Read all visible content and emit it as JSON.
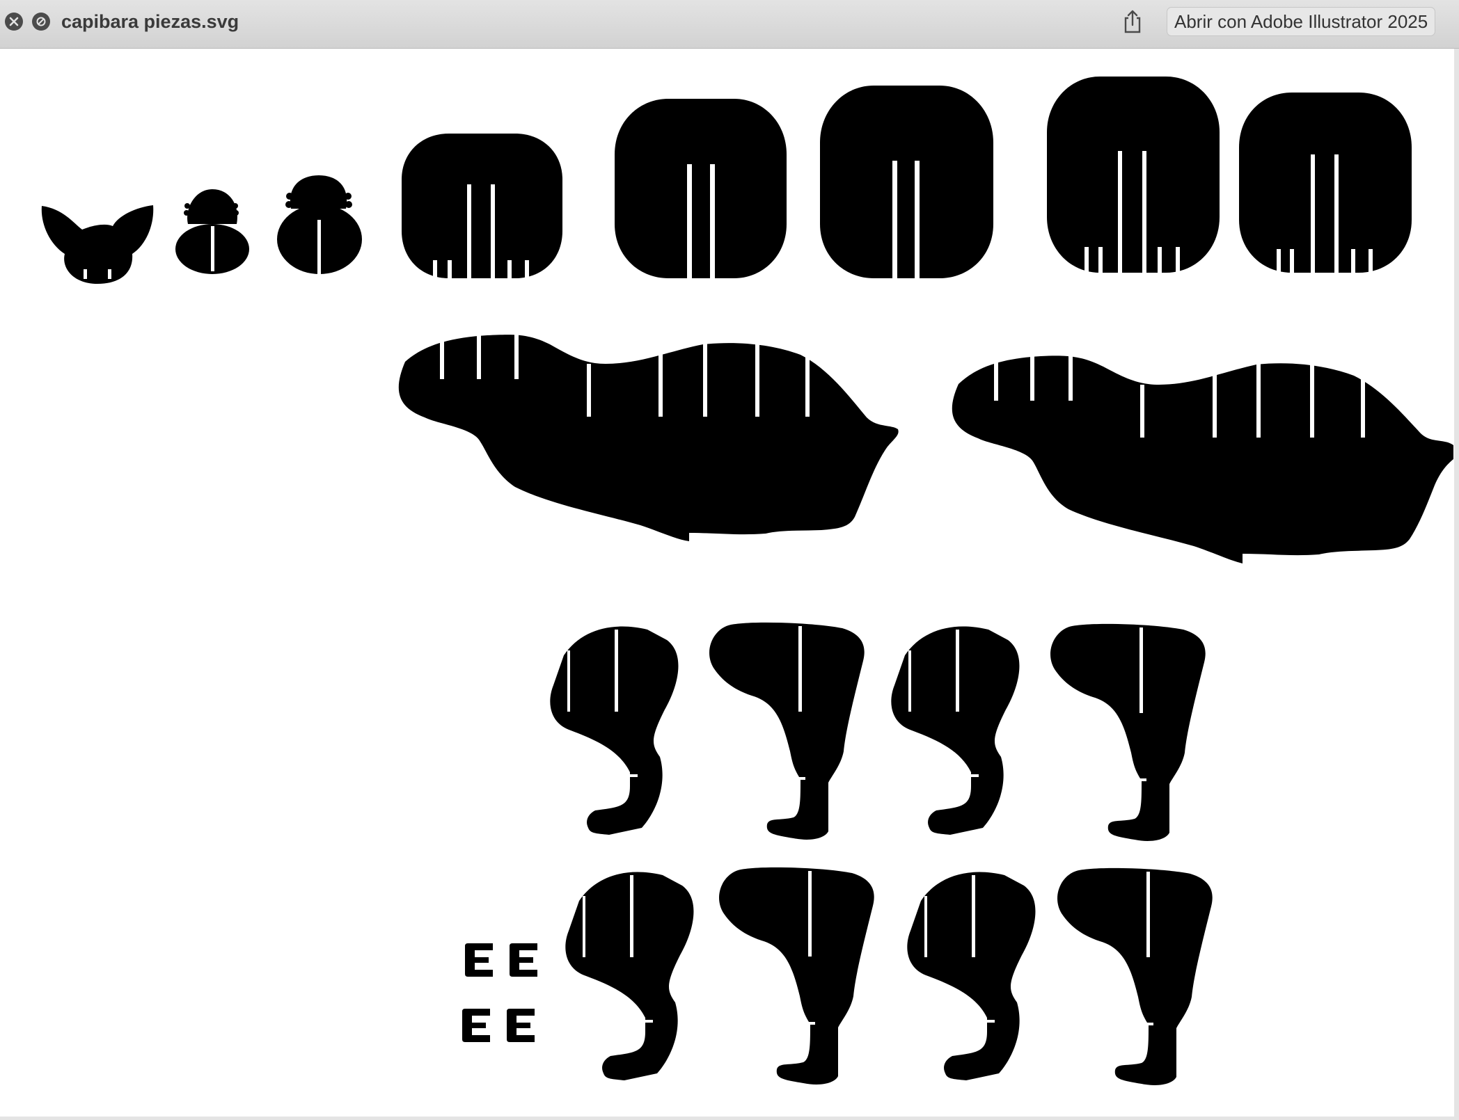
{
  "window": {
    "title": "capibara piezas.svg",
    "open_with_label": "Abrir con Adobe Illustrator 2025"
  },
  "toolbar": {
    "close_icon": "close-icon",
    "block_icon": "no-entry-icon",
    "share_icon": "share-icon"
  },
  "canvas": {
    "background": "#ffffff",
    "piece_color": "#000000",
    "pieces": [
      "ears",
      "eye-small",
      "eye-large",
      "head-slice-1",
      "head-slice-2",
      "head-slice-3",
      "head-slice-4",
      "head-slice-5",
      "body-left",
      "body-right",
      "leg-front-1",
      "leg-back-1",
      "leg-front-2",
      "leg-back-2",
      "leg-front-3",
      "leg-back-3",
      "leg-front-4",
      "leg-back-4",
      "clip-1",
      "clip-2",
      "clip-3",
      "clip-4"
    ]
  }
}
